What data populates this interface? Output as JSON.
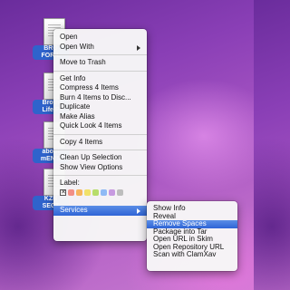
{
  "desktop": {
    "icons": [
      {
        "label_line1": "BRO",
        "label_line2": "FOR L"
      },
      {
        "label_line1": "Broth",
        "label_line2": "Life P"
      },
      {
        "label_line1": "about",
        "label_line2": "mEN'S"
      },
      {
        "label_line1": "KZN",
        "label_line2": "SECT"
      }
    ]
  },
  "context_menu": {
    "open": "Open",
    "open_with": "Open With",
    "move_to_trash": "Move to Trash",
    "get_info": "Get Info",
    "compress": "Compress 4 Items",
    "burn": "Burn 4 Items to Disc...",
    "duplicate": "Duplicate",
    "make_alias": "Make Alias",
    "quick_look": "Quick Look 4 Items",
    "copy": "Copy 4 Items",
    "clean_up": "Clean Up Selection",
    "show_view_options": "Show View Options",
    "label_heading": "Label:",
    "label_none_glyph": "✕",
    "label_colors": [
      "#f28f86",
      "#f6b55e",
      "#f1e16a",
      "#b7dd6b",
      "#8fbaf5",
      "#c79ae0",
      "#bdbdbd"
    ],
    "services": "Services"
  },
  "services_submenu": {
    "items": [
      "Show Info",
      "Reveal",
      "Remove Spaces",
      "Package into Tar",
      "Open URL in Skim",
      "Open Repository URL",
      "Scan with ClamXav"
    ]
  }
}
